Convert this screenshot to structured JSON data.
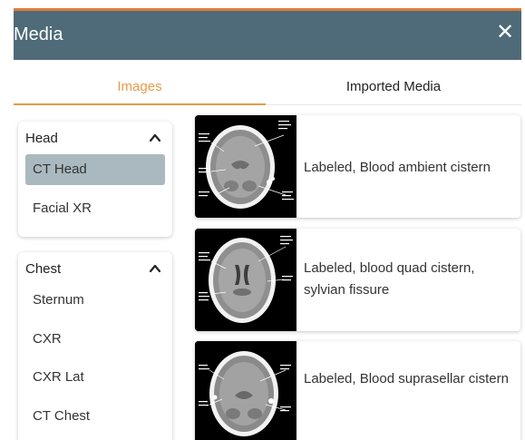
{
  "header": {
    "title": "Media",
    "close_glyph": "✕"
  },
  "tabs": [
    {
      "label": "Images",
      "active": true
    },
    {
      "label": "Imported Media",
      "active": false
    }
  ],
  "sidebar": {
    "groups": [
      {
        "title": "Head",
        "expanded": true,
        "items": [
          {
            "label": "CT Head",
            "selected": true
          },
          {
            "label": "Facial XR",
            "selected": false
          }
        ]
      },
      {
        "title": "Chest",
        "expanded": true,
        "items": [
          {
            "label": "Sternum",
            "selected": false
          },
          {
            "label": "CXR",
            "selected": false
          },
          {
            "label": "CXR Lat",
            "selected": false
          },
          {
            "label": "CT Chest",
            "selected": false
          }
        ]
      }
    ]
  },
  "media": [
    {
      "label": "Labeled, Blood ambient cistern",
      "thumbnail": "ct-head-scan"
    },
    {
      "label": "Labeled, blood quad cistern, sylvian fissure",
      "thumbnail": "ct-head-scan"
    },
    {
      "label": "Labeled, Blood suprasellar cistern",
      "thumbnail": "ct-head-scan"
    }
  ],
  "colors": {
    "accent": "#e89a4a",
    "header_bg": "#4f6a78",
    "selected_bg": "#a9b9bf"
  }
}
